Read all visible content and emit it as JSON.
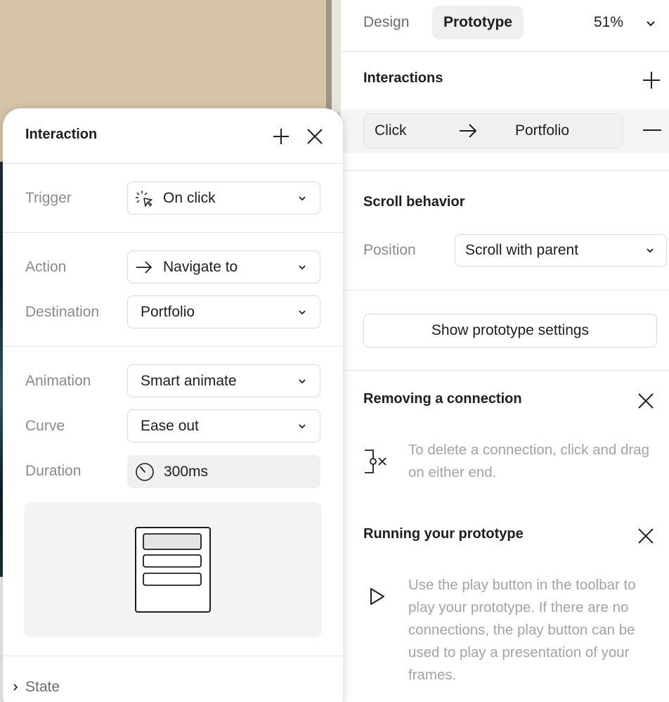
{
  "tabs": {
    "design": "Design",
    "prototype": "Prototype"
  },
  "zoom": "51%",
  "interactions": {
    "title": "Interactions",
    "item": {
      "trigger": "Click",
      "destination": "Portfolio"
    }
  },
  "scroll": {
    "title": "Scroll behavior",
    "position_label": "Position",
    "position_value": "Scroll with parent"
  },
  "settings_button": "Show prototype settings",
  "tip_remove": {
    "title": "Removing a connection",
    "text": "To delete a connection, click and drag on either end."
  },
  "tip_run": {
    "title": "Running your prototype",
    "text": "Use the play button in the toolbar to play your prototype. If there are no connections, the play button can be used to play a presentation of your frames."
  },
  "modal": {
    "title": "Interaction",
    "trigger_label": "Trigger",
    "trigger_value": "On click",
    "action_label": "Action",
    "action_value": "Navigate to",
    "destination_label": "Destination",
    "destination_value": "Portfolio",
    "animation_label": "Animation",
    "animation_value": "Smart animate",
    "curve_label": "Curve",
    "curve_value": "Ease out",
    "duration_label": "Duration",
    "duration_value": "300ms",
    "state_label": "State"
  },
  "colors": {
    "canvas_bg": "#d5c4a8",
    "text_primary": "#1e1e1e",
    "text_muted": "#8a8a8a",
    "tab_active_bg": "#efefef"
  }
}
